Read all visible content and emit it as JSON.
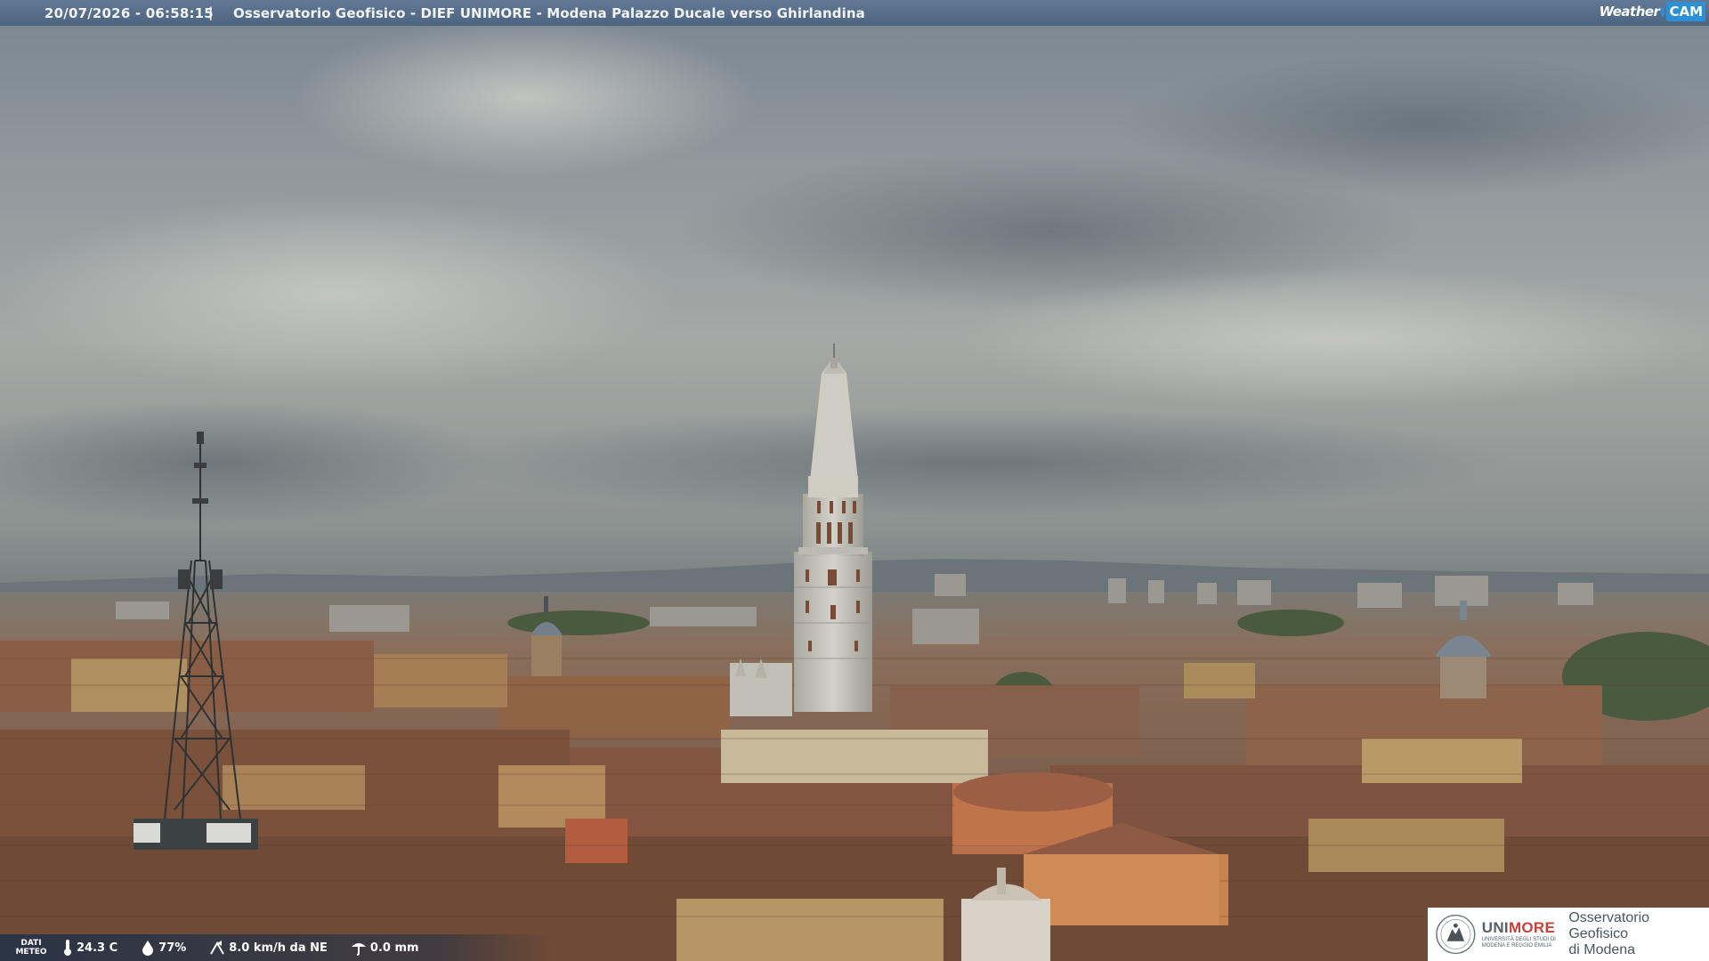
{
  "overlay": {
    "timestamp": "20/07/2026 - 06:58:15",
    "separator": "|",
    "camera_title": "Osservatorio Geofisico - DIEF UNIMORE - Modena Palazzo Ducale verso Ghirlandina"
  },
  "logo": {
    "word1": "Weather",
    "word2": "CAM",
    "accent": "#2d8fd4"
  },
  "weather": {
    "label_line1": "DATI",
    "label_line2": "METEO",
    "temperature": "24.3 C",
    "humidity": "77%",
    "wind": "8.0 km/h da NE",
    "rain": "0.0 mm",
    "icons": [
      "thermometer-icon",
      "humidity-drop-icon",
      "wind-icon",
      "rain-icon"
    ]
  },
  "institution": {
    "name_part1": "UNI",
    "name_part2": "MORE",
    "subtitle": "UNIVERSITÀ DEGLI STUDI DI MODENA E REGGIO EMILIA",
    "observatory_line1": "Osservatorio Geofisico",
    "observatory_line2": "di Modena",
    "accent": "#c7403a"
  }
}
